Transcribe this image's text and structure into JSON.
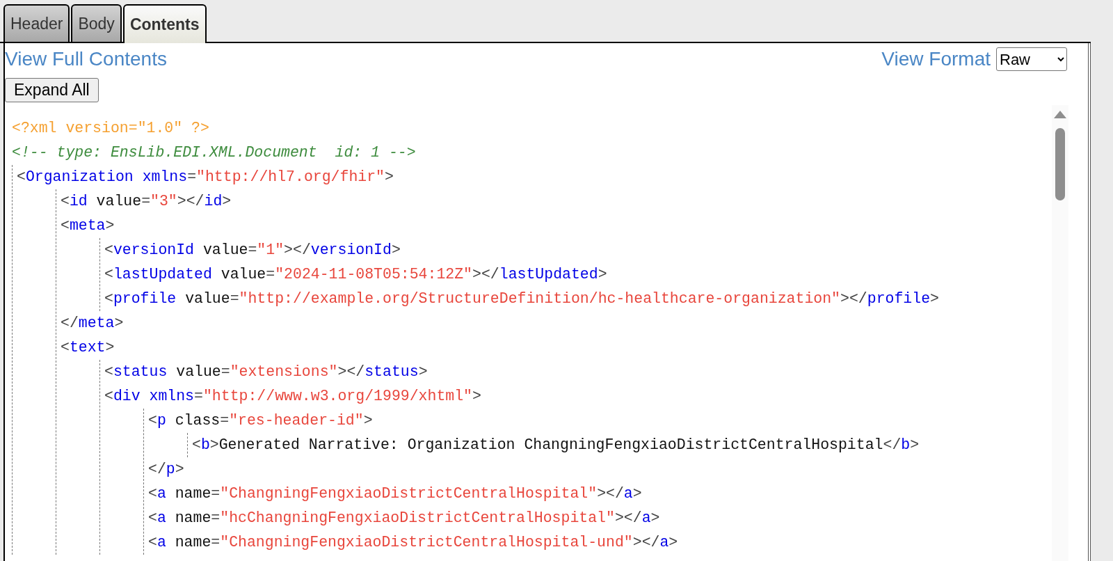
{
  "tabs": [
    {
      "label": "Header",
      "selected": false
    },
    {
      "label": "Body",
      "selected": false
    },
    {
      "label": "Contents",
      "selected": true
    }
  ],
  "view_full_contents": "View Full Contents",
  "view_format": {
    "label": "View Format",
    "value": "Raw"
  },
  "expand_all": "Expand All",
  "prolog": [
    {
      "tokens": [
        {
          "kind": "pi",
          "text": "<?xml version=\"1.0\" ?>"
        }
      ]
    },
    {
      "tokens": [
        {
          "kind": "comment",
          "text": "<!-- type: EnsLib.EDI.XML.Document  id: 1 -->"
        }
      ]
    }
  ],
  "document": [
    {
      "tokens": [
        {
          "kind": "punct",
          "text": "<"
        },
        {
          "kind": "tag",
          "text": "Organization xmlns"
        },
        {
          "kind": "punct",
          "text": "="
        },
        {
          "kind": "value",
          "text": "\"http://hl7.org/fhir\""
        },
        {
          "kind": "punct",
          "text": ">"
        }
      ],
      "children": [
        {
          "tokens": [
            {
              "kind": "punct",
              "text": "<"
            },
            {
              "kind": "tag",
              "text": "id"
            },
            {
              "kind": "attr",
              "text": " value"
            },
            {
              "kind": "punct",
              "text": "="
            },
            {
              "kind": "value",
              "text": "\"3\""
            },
            {
              "kind": "punct",
              "text": "></"
            },
            {
              "kind": "tag",
              "text": "id"
            },
            {
              "kind": "punct",
              "text": ">"
            }
          ]
        },
        {
          "tokens": [
            {
              "kind": "punct",
              "text": "<"
            },
            {
              "kind": "tag",
              "text": "meta"
            },
            {
              "kind": "punct",
              "text": ">"
            }
          ],
          "children": [
            {
              "tokens": [
                {
                  "kind": "punct",
                  "text": "<"
                },
                {
                  "kind": "tag",
                  "text": "versionId"
                },
                {
                  "kind": "attr",
                  "text": " value"
                },
                {
                  "kind": "punct",
                  "text": "="
                },
                {
                  "kind": "value",
                  "text": "\"1\""
                },
                {
                  "kind": "punct",
                  "text": "></"
                },
                {
                  "kind": "tag",
                  "text": "versionId"
                },
                {
                  "kind": "punct",
                  "text": ">"
                }
              ]
            },
            {
              "tokens": [
                {
                  "kind": "punct",
                  "text": "<"
                },
                {
                  "kind": "tag",
                  "text": "lastUpdated"
                },
                {
                  "kind": "attr",
                  "text": " value"
                },
                {
                  "kind": "punct",
                  "text": "="
                },
                {
                  "kind": "value",
                  "text": "\"2024-11-08T05:54:12Z\""
                },
                {
                  "kind": "punct",
                  "text": "></"
                },
                {
                  "kind": "tag",
                  "text": "lastUpdated"
                },
                {
                  "kind": "punct",
                  "text": ">"
                }
              ]
            },
            {
              "tokens": [
                {
                  "kind": "punct",
                  "text": "<"
                },
                {
                  "kind": "tag",
                  "text": "profile"
                },
                {
                  "kind": "attr",
                  "text": " value"
                },
                {
                  "kind": "punct",
                  "text": "="
                },
                {
                  "kind": "value",
                  "text": "\"http://example.org/StructureDefinition/hc-healthcare-organization\""
                },
                {
                  "kind": "punct",
                  "text": "></"
                },
                {
                  "kind": "tag",
                  "text": "profile"
                },
                {
                  "kind": "punct",
                  "text": ">"
                }
              ]
            }
          ]
        },
        {
          "tokens": [
            {
              "kind": "punct",
              "text": "</"
            },
            {
              "kind": "tag",
              "text": "meta"
            },
            {
              "kind": "punct",
              "text": ">"
            }
          ]
        },
        {
          "tokens": [
            {
              "kind": "punct",
              "text": "<"
            },
            {
              "kind": "tag",
              "text": "text"
            },
            {
              "kind": "punct",
              "text": ">"
            }
          ],
          "children": [
            {
              "tokens": [
                {
                  "kind": "punct",
                  "text": "<"
                },
                {
                  "kind": "tag",
                  "text": "status"
                },
                {
                  "kind": "attr",
                  "text": " value"
                },
                {
                  "kind": "punct",
                  "text": "="
                },
                {
                  "kind": "value",
                  "text": "\"extensions\""
                },
                {
                  "kind": "punct",
                  "text": "></"
                },
                {
                  "kind": "tag",
                  "text": "status"
                },
                {
                  "kind": "punct",
                  "text": ">"
                }
              ]
            },
            {
              "tokens": [
                {
                  "kind": "punct",
                  "text": "<"
                },
                {
                  "kind": "tag",
                  "text": "div xmlns"
                },
                {
                  "kind": "punct",
                  "text": "="
                },
                {
                  "kind": "value",
                  "text": "\"http://www.w3.org/1999/xhtml\""
                },
                {
                  "kind": "punct",
                  "text": ">"
                }
              ],
              "children": [
                {
                  "tokens": [
                    {
                      "kind": "punct",
                      "text": "<"
                    },
                    {
                      "kind": "tag",
                      "text": "p"
                    },
                    {
                      "kind": "attr",
                      "text": " class"
                    },
                    {
                      "kind": "punct",
                      "text": "="
                    },
                    {
                      "kind": "value",
                      "text": "\"res-header-id\""
                    },
                    {
                      "kind": "punct",
                      "text": ">"
                    }
                  ],
                  "children": [
                    {
                      "tokens": [
                        {
                          "kind": "punct",
                          "text": "<"
                        },
                        {
                          "kind": "tag",
                          "text": "b"
                        },
                        {
                          "kind": "punct",
                          "text": ">"
                        },
                        {
                          "kind": "text",
                          "text": "Generated Narrative: Organization ChangningFengxiaoDistrictCentralHospital"
                        },
                        {
                          "kind": "punct",
                          "text": "</"
                        },
                        {
                          "kind": "tag",
                          "text": "b"
                        },
                        {
                          "kind": "punct",
                          "text": ">"
                        }
                      ]
                    }
                  ]
                },
                {
                  "tokens": [
                    {
                      "kind": "punct",
                      "text": "</"
                    },
                    {
                      "kind": "tag",
                      "text": "p"
                    },
                    {
                      "kind": "punct",
                      "text": ">"
                    }
                  ]
                },
                {
                  "tokens": [
                    {
                      "kind": "punct",
                      "text": "<"
                    },
                    {
                      "kind": "tag",
                      "text": "a"
                    },
                    {
                      "kind": "attr",
                      "text": " name"
                    },
                    {
                      "kind": "punct",
                      "text": "="
                    },
                    {
                      "kind": "value",
                      "text": "\"ChangningFengxiaoDistrictCentralHospital\""
                    },
                    {
                      "kind": "punct",
                      "text": "></"
                    },
                    {
                      "kind": "tag",
                      "text": "a"
                    },
                    {
                      "kind": "punct",
                      "text": ">"
                    }
                  ]
                },
                {
                  "tokens": [
                    {
                      "kind": "punct",
                      "text": "<"
                    },
                    {
                      "kind": "tag",
                      "text": "a"
                    },
                    {
                      "kind": "attr",
                      "text": " name"
                    },
                    {
                      "kind": "punct",
                      "text": "="
                    },
                    {
                      "kind": "value",
                      "text": "\"hcChangningFengxiaoDistrictCentralHospital\""
                    },
                    {
                      "kind": "punct",
                      "text": "></"
                    },
                    {
                      "kind": "tag",
                      "text": "a"
                    },
                    {
                      "kind": "punct",
                      "text": ">"
                    }
                  ]
                },
                {
                  "tokens": [
                    {
                      "kind": "punct",
                      "text": "<"
                    },
                    {
                      "kind": "tag",
                      "text": "a"
                    },
                    {
                      "kind": "attr",
                      "text": " name"
                    },
                    {
                      "kind": "punct",
                      "text": "="
                    },
                    {
                      "kind": "value",
                      "text": "\"ChangningFengxiaoDistrictCentralHospital-und\""
                    },
                    {
                      "kind": "punct",
                      "text": "></"
                    },
                    {
                      "kind": "tag",
                      "text": "a"
                    },
                    {
                      "kind": "punct",
                      "text": ">"
                    }
                  ]
                }
              ]
            }
          ]
        }
      ]
    }
  ]
}
